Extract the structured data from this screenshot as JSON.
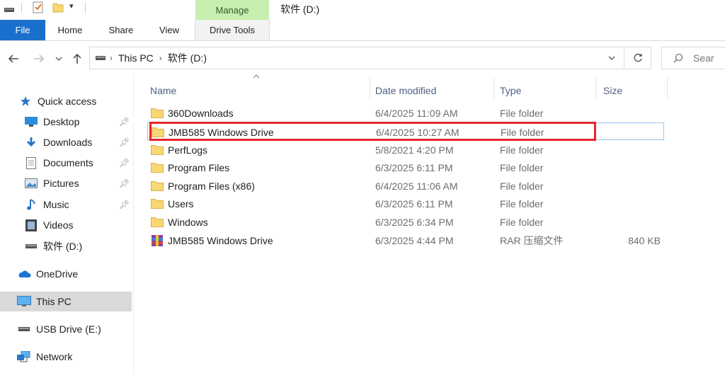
{
  "window": {
    "title": "软件 (D:)"
  },
  "ribbon": {
    "context_tab": "Manage",
    "tabs": [
      {
        "label": "File"
      },
      {
        "label": "Home"
      },
      {
        "label": "Share"
      },
      {
        "label": "View"
      },
      {
        "label": "Drive Tools"
      }
    ]
  },
  "address": {
    "segments": [
      "This PC",
      "软件 (D:)"
    ],
    "search_placeholder": "Sear"
  },
  "sidebar": {
    "items": [
      {
        "label": "Quick access",
        "icon": "star-icon",
        "pinned": false
      },
      {
        "label": "Desktop",
        "icon": "desktop-icon",
        "pinned": true
      },
      {
        "label": "Downloads",
        "icon": "download-icon",
        "pinned": true
      },
      {
        "label": "Documents",
        "icon": "document-icon",
        "pinned": true
      },
      {
        "label": "Pictures",
        "icon": "pictures-icon",
        "pinned": true
      },
      {
        "label": "Music",
        "icon": "music-icon",
        "pinned": true
      },
      {
        "label": "Videos",
        "icon": "video-icon",
        "pinned": false
      },
      {
        "label": "软件 (D:)",
        "icon": "drive-icon",
        "pinned": false
      },
      {
        "label": "OneDrive",
        "icon": "cloud-icon",
        "pinned": false
      },
      {
        "label": "This PC",
        "icon": "computer-icon",
        "pinned": false,
        "selected": true
      },
      {
        "label": "USB Drive (E:)",
        "icon": "usb-drive-icon",
        "pinned": false
      },
      {
        "label": "Network",
        "icon": "network-icon",
        "pinned": false
      }
    ]
  },
  "file_list": {
    "columns": {
      "name": "Name",
      "date": "Date modified",
      "type": "Type",
      "size": "Size"
    },
    "rows": [
      {
        "name": "360Downloads",
        "date": "6/4/2025 11:09 AM",
        "type": "File folder",
        "size": "",
        "icon": "folder-icon"
      },
      {
        "name": "JMB585 Windows Drive",
        "date": "6/4/2025 10:27 AM",
        "type": "File folder",
        "size": "",
        "icon": "folder-icon",
        "highlighted": true
      },
      {
        "name": "PerfLogs",
        "date": "5/8/2021 4:20 PM",
        "type": "File folder",
        "size": "",
        "icon": "folder-icon"
      },
      {
        "name": "Program Files",
        "date": "6/3/2025 6:11 PM",
        "type": "File folder",
        "size": "",
        "icon": "folder-icon"
      },
      {
        "name": "Program Files (x86)",
        "date": "6/4/2025 11:06 AM",
        "type": "File folder",
        "size": "",
        "icon": "folder-icon"
      },
      {
        "name": "Users",
        "date": "6/3/2025 6:11 PM",
        "type": "File folder",
        "size": "",
        "icon": "folder-icon"
      },
      {
        "name": "Windows",
        "date": "6/3/2025 6:34 PM",
        "type": "File folder",
        "size": "",
        "icon": "folder-icon"
      },
      {
        "name": "JMB585 Windows Drive",
        "date": "6/3/2025 4:44 PM",
        "type": "RAR 压缩文件",
        "size": "840 KB",
        "icon": "rar-archive-icon"
      }
    ]
  },
  "colors": {
    "file_tab": "#1a6fcc",
    "manage_tab": "#c6efb0",
    "highlight_border": "#e8242c",
    "column_header": "#4d6082"
  }
}
